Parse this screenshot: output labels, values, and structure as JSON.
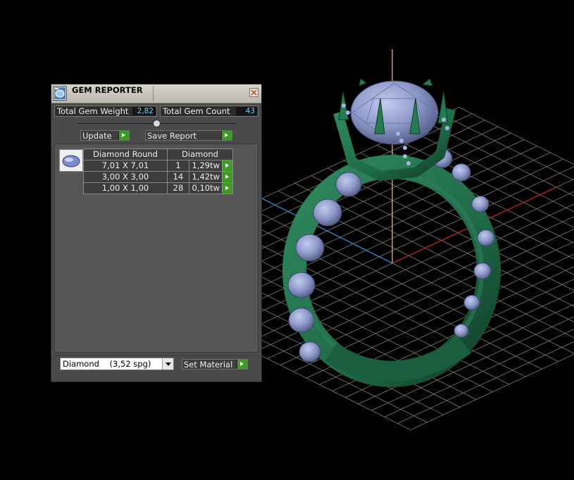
{
  "panel": {
    "title": "GEM REPORTER",
    "total_weight_label": "Total Gem Weight",
    "total_weight_value": "2,82",
    "total_count_label": "Total Gem Count",
    "total_count_value": "43",
    "update_label": "Update",
    "save_report_label": "Save Report",
    "table": {
      "headers": [
        "Diamond Round",
        "Diamond"
      ],
      "rows": [
        {
          "size": "7,01 X 7,01",
          "count": "1",
          "weight": "1,29tw"
        },
        {
          "size": "3,00 X 3,00",
          "count": "14",
          "weight": "1,42tw"
        },
        {
          "size": "1,00 X 1,00",
          "count": "28",
          "weight": "0,10tw"
        }
      ]
    },
    "material_select": "Diamond    (3,52 spg)",
    "set_material_label": "Set Material"
  },
  "icons": {
    "app": "gem-reporter-icon",
    "close": "close-icon",
    "thumb": "round-diamond-icon",
    "go": "play-arrow-icon",
    "dropdown": "chevron-down-icon"
  },
  "colors": {
    "ring_metal": "#1f6b48",
    "gems": "#8b97c8",
    "accent_green": "#3f9a28",
    "value_text": "#6fd4ff",
    "axis_x": "#c02020",
    "axis_y": "#2a8acb",
    "axis_z": "#d8a86a"
  }
}
